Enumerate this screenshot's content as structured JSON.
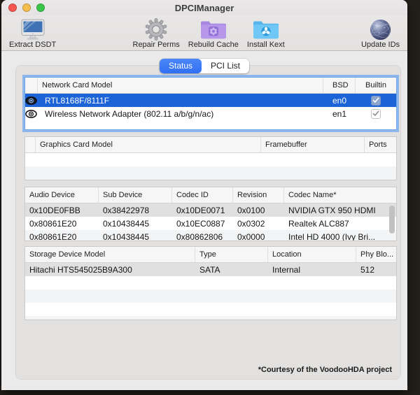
{
  "window": {
    "title": "DPCIManager"
  },
  "traffic_lights": {
    "close": "#f6564f",
    "minimize": "#f5bd4e",
    "zoom": "#39c649"
  },
  "toolbar": {
    "items": [
      {
        "label": "Extract DSDT",
        "icon": "imac-display-icon"
      },
      {
        "label": "Repair Perms",
        "icon": "gear-icon"
      },
      {
        "label": "Rebuild Cache",
        "icon": "purple-folder-gear-icon"
      },
      {
        "label": "Install Kext",
        "icon": "blue-folder-kext-icon"
      },
      {
        "label": "Update IDs",
        "icon": "globe-network-icon"
      }
    ]
  },
  "tabs": [
    {
      "label": "Status",
      "selected": true
    },
    {
      "label": "PCI List",
      "selected": false
    }
  ],
  "tables": {
    "network": {
      "columns": [
        "",
        "Network Card Model",
        "BSD",
        "Builtin"
      ],
      "rows": [
        {
          "model": "RTL8168F/8111F",
          "bsd": "en0",
          "builtin": true,
          "state": "selected-active"
        },
        {
          "model": "Wireless Network Adapter (802.11 a/b/g/n/ac)",
          "bsd": "en1",
          "builtin": true,
          "state": "none"
        }
      ]
    },
    "graphics": {
      "columns": [
        "",
        "Graphics Card Model",
        "Framebuffer",
        "Ports"
      ],
      "rows": []
    },
    "audio": {
      "columns": [
        "Audio Device",
        "Sub Device",
        "Codec ID",
        "Revision",
        "Codec Name*"
      ],
      "rows": [
        {
          "cells": [
            "0x10DE0FBB",
            "0x38422978",
            "0x10DE0071",
            "0x0100",
            "NVIDIA GTX 950 HDMI"
          ],
          "state": "selected-inactive"
        },
        {
          "cells": [
            "0x80861E20",
            "0x10438445",
            "0x10EC0887",
            "0x0302",
            "Realtek ALC887"
          ],
          "state": "none"
        },
        {
          "cells": [
            "0x80861E20",
            "0x10438445",
            "0x80862806",
            "0x0000",
            "Intel HD 4000 (Ivy Bri..."
          ],
          "state": "stripe"
        }
      ]
    },
    "storage": {
      "columns": [
        "Storage Device Model",
        "Type",
        "Location",
        "Phy Blo..."
      ],
      "rows": [
        {
          "cells": [
            "Hitachi HTS545025B9A300",
            "SATA",
            "Internal",
            "512"
          ],
          "state": "selected-inactive"
        }
      ]
    }
  },
  "footer": {
    "credit": "*Courtesy of the VoodooHDA project"
  },
  "colors": {
    "selection_blue": "#1c63d8",
    "tab_selected_blue": "#3b7cf6",
    "focus_ring": "#7aacee",
    "inactive_selection": "#e0e0e0"
  }
}
